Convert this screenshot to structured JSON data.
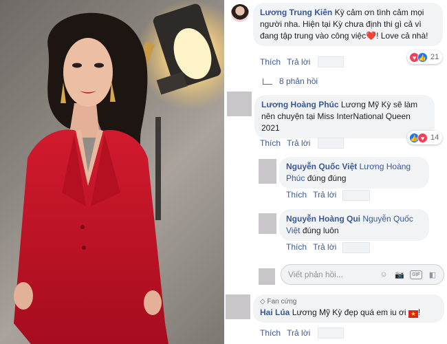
{
  "comments": [
    {
      "author": "Lương Trung Kiên",
      "text_1": "Kỳ cảm ơn tình cảm mọi người nha. Hiện tại Kỳ chưa định thi gì cả vì đang tập trung vào công việc",
      "text_2": "! Love cả nhà!",
      "emoji": "heart",
      "actions": {
        "like": "Thích",
        "reply": "Trả lời"
      },
      "reaction_count": "21",
      "replies_label": "8 phản hồi"
    },
    {
      "author": "Lương Hoàng Phúc",
      "text": "Lương Mỹ Kỳ sẽ làm nên chuyện tại Miss InterNational Queen 2021",
      "actions": {
        "like": "Thích",
        "reply": "Trả lời"
      },
      "reaction_count": "14"
    }
  ],
  "replies": [
    {
      "author": "Nguyễn Quốc Việt",
      "mention": "Lương Hoàng Phúc",
      "text": "đúng đúng",
      "actions": {
        "like": "Thích",
        "reply": "Trả lời"
      }
    },
    {
      "author": "Nguyễn Hoàng Qui",
      "mention": "Nguyễn Quốc Việt",
      "text": "đúng luôn",
      "actions": {
        "like": "Thích",
        "reply": "Trả lời"
      }
    }
  ],
  "reply_box": {
    "placeholder": "Viết phản hồi..."
  },
  "last_comment": {
    "badge": "Fan cứng",
    "author": "Hai Lúa",
    "text": "Lương Mỹ Kỳ đẹp quá em iu ơi",
    "suffix": "!",
    "flag": "vietnam-flag",
    "actions": {
      "like": "Thích",
      "reply": "Trả lời"
    }
  },
  "colors": {
    "link": "#385898",
    "bubble": "#f2f3f5",
    "love": "#f33e58",
    "like": "#1877f2",
    "suit": "#c8102e"
  }
}
